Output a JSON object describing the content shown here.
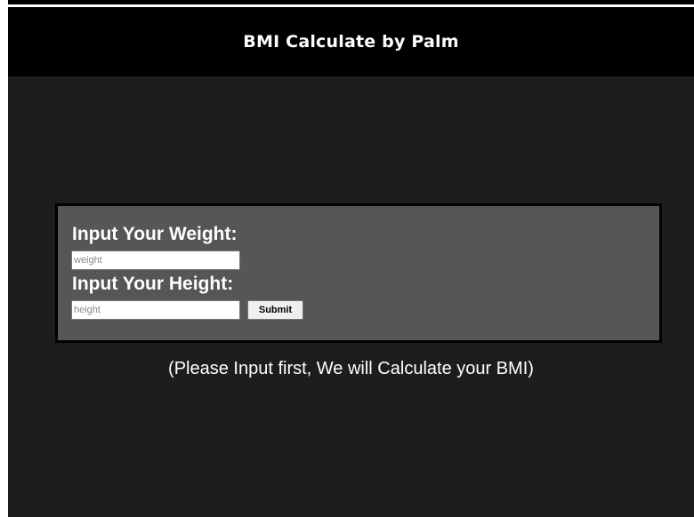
{
  "header": {
    "title": "BMI Calculate by Palm"
  },
  "form": {
    "weight_label": "Input Your Weight:",
    "weight_placeholder": "weight",
    "weight_value": "",
    "height_label": "Input Your Height:",
    "height_placeholder": "height",
    "height_value": "",
    "submit_label": "Submit"
  },
  "result": {
    "message": "(Please Input first, We will Calculate your BMI)"
  },
  "colors": {
    "page_background": "#1d1d1d",
    "header_background": "#000000",
    "panel_background": "#565656",
    "text": "#ffffff"
  }
}
